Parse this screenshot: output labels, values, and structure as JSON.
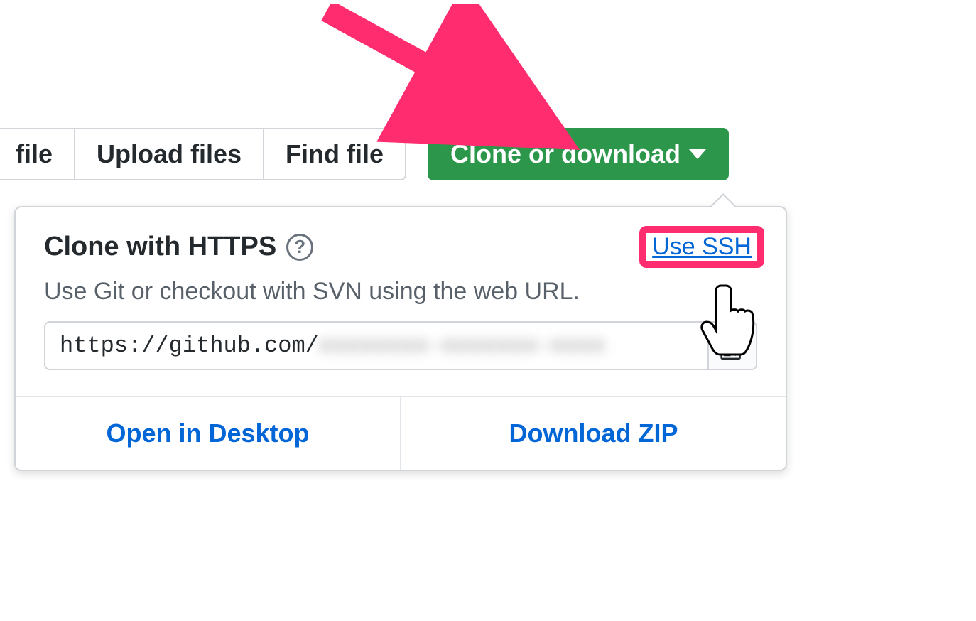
{
  "toolbar": {
    "new_file_label": "file",
    "upload_files_label": "Upload files",
    "find_file_label": "Find file",
    "clone_download_label": "Clone or download"
  },
  "clone_popover": {
    "title": "Clone with HTTPS",
    "help_glyph": "?",
    "use_ssh_label": "Use SSH",
    "description": "Use Git or checkout with SVN using the web URL.",
    "url_prefix": "https://github.com/",
    "url_obscured": "xxxxxxxx-xxxxxxx-xxxx",
    "open_desktop_label": "Open in Desktop",
    "download_zip_label": "Download ZIP"
  }
}
